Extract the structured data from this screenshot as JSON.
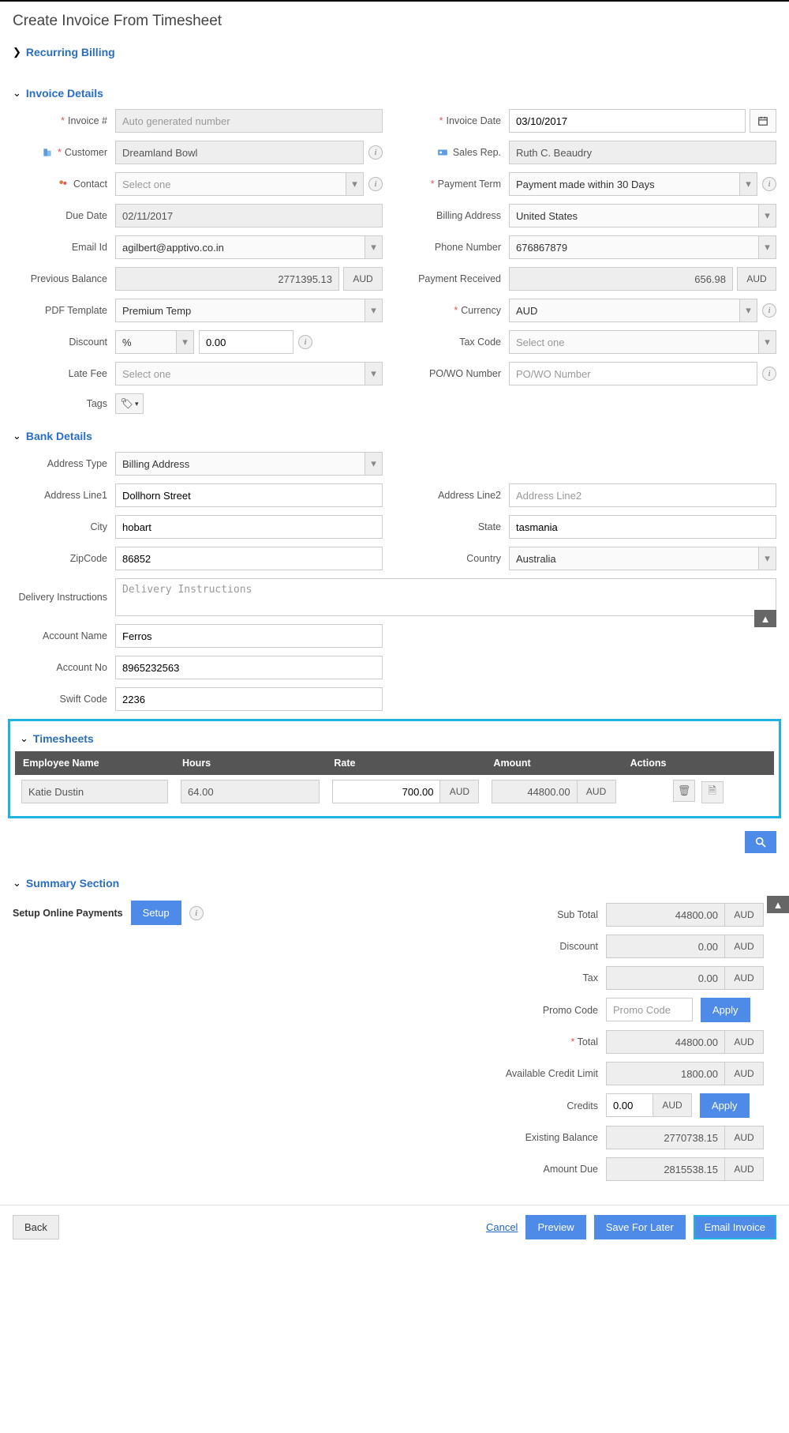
{
  "title": "Create Invoice From Timesheet",
  "sections": {
    "recurring": "Recurring Billing",
    "invoice": "Invoice Details",
    "bank": "Bank Details",
    "timesheets": "Timesheets",
    "summary": "Summary Section"
  },
  "inv": {
    "invoiceNoLbl": "Invoice #",
    "invoiceNoPh": "Auto generated number",
    "invoiceDateLbl": "Invoice Date",
    "invoiceDate": "03/10/2017",
    "customerLbl": "Customer",
    "customer": "Dreamland Bowl",
    "salesRepLbl": "Sales Rep.",
    "salesRep": "Ruth C. Beaudry",
    "contactLbl": "Contact",
    "contactPh": "Select one",
    "paymentTermLbl": "Payment Term",
    "paymentTerm": "Payment made within 30 Days",
    "dueDateLbl": "Due Date",
    "dueDate": "02/11/2017",
    "billingAddrLbl": "Billing Address",
    "billingAddr": "United States",
    "emailLbl": "Email Id",
    "email": "agilbert@apptivo.co.in",
    "phoneLbl": "Phone Number",
    "phone": "676867879",
    "prevBalLbl": "Previous Balance",
    "prevBal": "2771395.13",
    "payRecvLbl": "Payment Received",
    "payRecv": "656.98",
    "pdfTplLbl": "PDF Template",
    "pdfTpl": "Premium Temp",
    "currencyLbl": "Currency",
    "currency": "AUD",
    "discountLbl": "Discount",
    "discountType": "%",
    "discountVal": "0.00",
    "taxCodeLbl": "Tax Code",
    "taxCodePh": "Select one",
    "lateFeeLbl": "Late Fee",
    "lateFeePh": "Select one",
    "poLbl": "PO/WO Number",
    "poPh": "PO/WO Number",
    "tagsLbl": "Tags",
    "unit": "AUD"
  },
  "bank": {
    "addrTypeLbl": "Address Type",
    "addrType": "Billing Address",
    "line1Lbl": "Address Line1",
    "line1": "Dollhorn Street",
    "line2Lbl": "Address Line2",
    "line2Ph": "Address Line2",
    "cityLbl": "City",
    "city": "hobart",
    "stateLbl": "State",
    "state": "tasmania",
    "zipLbl": "ZipCode",
    "zip": "86852",
    "countryLbl": "Country",
    "country": "Australia",
    "deliveryLbl": "Delivery Instructions",
    "deliveryPh": "Delivery Instructions",
    "acctNameLbl": "Account Name",
    "acctName": "Ferros",
    "acctNoLbl": "Account No",
    "acctNo": "8965232563",
    "swiftLbl": "Swift Code",
    "swift": "2236"
  },
  "ts": {
    "h1": "Employee Name",
    "h2": "Hours",
    "h3": "Rate",
    "h4": "Amount",
    "h5": "Actions",
    "emp": "Katie Dustin",
    "hours": "64.00",
    "rate": "700.00",
    "amount": "44800.00",
    "unit": "AUD"
  },
  "sum": {
    "setupLbl": "Setup Online Payments",
    "setupBtn": "Setup",
    "subTotalLbl": "Sub Total",
    "subTotal": "44800.00",
    "discountLbl": "Discount",
    "discount": "0.00",
    "taxLbl": "Tax",
    "tax": "0.00",
    "promoLbl": "Promo Code",
    "promoPh": "Promo Code",
    "applyBtn": "Apply",
    "totalLbl": "Total",
    "total": "44800.00",
    "creditLimitLbl": "Available Credit Limit",
    "creditLimit": "1800.00",
    "creditsLbl": "Credits",
    "credits": "0.00",
    "existBalLbl": "Existing Balance",
    "existBal": "2770738.15",
    "amountDueLbl": "Amount Due",
    "amountDue": "2815538.15",
    "unit": "AUD"
  },
  "footer": {
    "back": "Back",
    "cancel": "Cancel",
    "preview": "Preview",
    "saveLater": "Save For Later",
    "emailInv": "Email Invoice"
  }
}
